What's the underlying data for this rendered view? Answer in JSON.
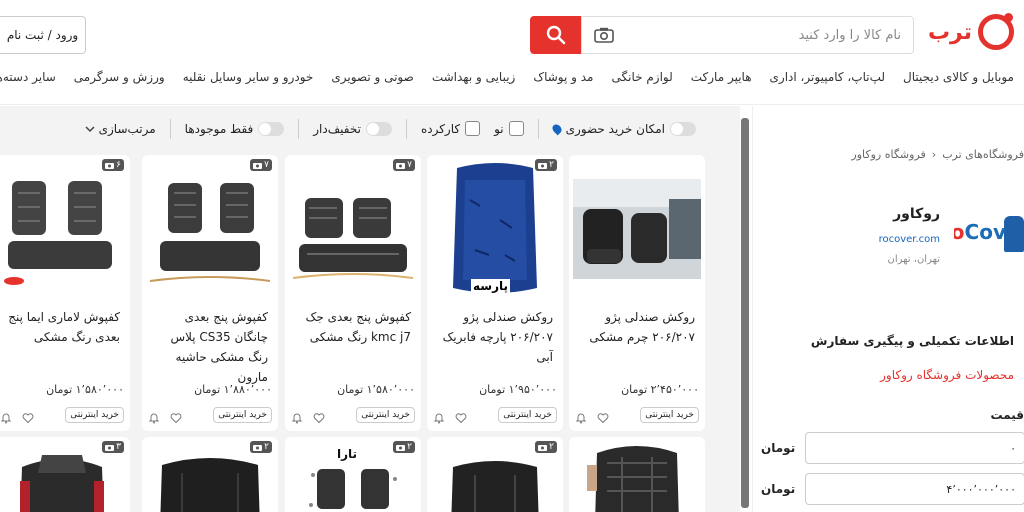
{
  "header": {
    "logo_text": "ترب",
    "search_placeholder": "نام کالا را وارد کنید",
    "login_label": "ورود / ثبت نام",
    "categories": [
      "موبایل و کالای دیجیتال",
      "لپ‌تاپ، کامپیوتر، اداری",
      "هایپر مارکت",
      "لوازم خانگی",
      "مد و پوشاک",
      "زیبایی و بهداشت",
      "صوتی و تصویری",
      "خودرو و سایر وسایل نقلیه",
      "ورزش و سرگرمی",
      "سایر دسته‌ها"
    ]
  },
  "filters": {
    "in_person": "امکان خرید حضوری",
    "new": "نو",
    "used": "کارکرده",
    "discount": "تخفیف‌دار",
    "in_stock": "فقط موجودها",
    "sort": "مرتب‌سازی"
  },
  "sidebar": {
    "crumb_root": "فروشگاه‌های ترب",
    "crumb_sep": "‹",
    "crumb_current": "فروشگاه روکاور",
    "shop_name": "روکاور",
    "shop_url": "rocover.com",
    "shop_location": "تهران، تهران",
    "logo_text_r": "Ro",
    "logo_text_c": "Cov",
    "follow_link": "اطلاعات تکمیلی و پیگیری سفارش",
    "products_link": "محصولات فروشگاه روکاور",
    "price_title": "قیمت",
    "price_min": "۰",
    "price_max": "۴٬۰۰۰٬۰۰۰٬۰۰۰",
    "price_unit": "تومان"
  },
  "products": [
    {
      "title": "روکش صندلی پژو ۲۰۶/۲۰۷ چرم مشکی",
      "price": "۲٬۴۵۰٬۰۰۰ تومان",
      "badge": "",
      "buy": "خرید اینترنتی",
      "image": "car-seat-interior"
    },
    {
      "title": "روکش صندلی پژو ۲۰۶/۲۰۷ پارچه فابریک آبی",
      "price": "۱٬۹۵۰٬۰۰۰ تومان",
      "badge": "۲",
      "buy": "خرید اینترنتی",
      "image": "blue-seat-cover",
      "watermark": "پارسه"
    },
    {
      "title": "کفپوش پنج بعدی جک kmc j7 رنگ مشکی",
      "price": "۱٬۵۸۰٬۰۰۰ تومان",
      "badge": "۷",
      "buy": "خرید اینترنتی",
      "image": "floor-mats"
    },
    {
      "title": "کفپوش پنج بعدی چانگان CS35 پلاس رنگ مشکی حاشیه مارون",
      "price": "۱٬۸۸۰٬۰۰۰ تومان",
      "badge": "۷",
      "buy": "خرید اینترنتی",
      "image": "floor-mats"
    },
    {
      "title": "کفپوش لاماری ایما پنج بعدی رنگ مشکی",
      "price": "۱٬۵۸۰٬۰۰۰ تومان",
      "badge": "۶",
      "buy": "خرید اینترنتی",
      "image": "floor-mats"
    }
  ],
  "products_row2": [
    {
      "badge": "",
      "image": "seat-cover-dark"
    },
    {
      "badge": "۲",
      "image": "seat-cover-black"
    },
    {
      "badge": "۲",
      "image": "floor-mats-tara",
      "watermark": "تارا"
    },
    {
      "badge": "۲",
      "image": "seat-cover-black"
    },
    {
      "badge": "۳",
      "image": "seat-cover-red"
    }
  ],
  "colors": {
    "accent": "#e5322d",
    "link": "#1565c0"
  }
}
